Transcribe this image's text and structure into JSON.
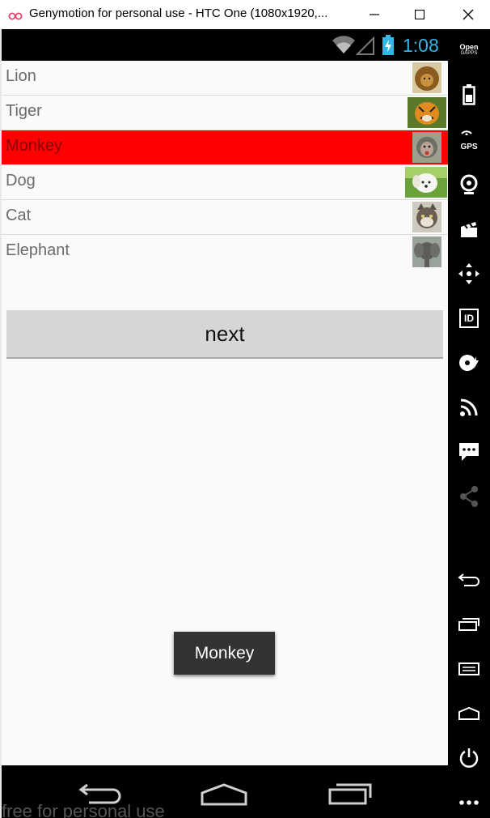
{
  "window": {
    "title": "Genymotion for personal use - HTC One (1080x1920,...",
    "controls": [
      "minimize-icon",
      "maximize-icon",
      "close-icon"
    ]
  },
  "statusbar": {
    "time": "1:08",
    "time_color": "#33b5e5",
    "icons": [
      "wifi-icon",
      "signal-icon",
      "battery-charging-icon"
    ]
  },
  "list": {
    "items": [
      {
        "label": "Lion",
        "thumbnail": "lion-thumbnail",
        "selected": false
      },
      {
        "label": "Tiger",
        "thumbnail": "tiger-thumbnail",
        "selected": false
      },
      {
        "label": "Monkey",
        "thumbnail": "monkey-thumbnail",
        "selected": true
      },
      {
        "label": "Dog",
        "thumbnail": "dog-thumbnail",
        "selected": false
      },
      {
        "label": "Cat",
        "thumbnail": "cat-thumbnail",
        "selected": false
      },
      {
        "label": "Elephant",
        "thumbnail": "elephant-thumbnail",
        "selected": false
      }
    ],
    "selected_color": "#ff0000"
  },
  "next_button": {
    "label": "next"
  },
  "toast": {
    "text": "Monkey"
  },
  "navbar": {
    "icons": [
      "back-icon",
      "home-icon",
      "recent-apps-icon"
    ]
  },
  "watermark": "free for personal use",
  "sidepanel": {
    "opengapps": {
      "line1": "Open",
      "line2": "GAPPS"
    },
    "gps_label": "GPS",
    "id_label": "ID",
    "tools": [
      "opengapps-icon",
      "battery-icon",
      "gps-icon",
      "camera-icon",
      "media-icon",
      "dpad-icon",
      "identifiers-icon",
      "disk-icon",
      "cast-icon",
      "sms-icon",
      "share-icon",
      "back-icon",
      "recent-apps-icon",
      "menu-icon",
      "home-icon",
      "power-icon",
      "more-icon"
    ]
  }
}
